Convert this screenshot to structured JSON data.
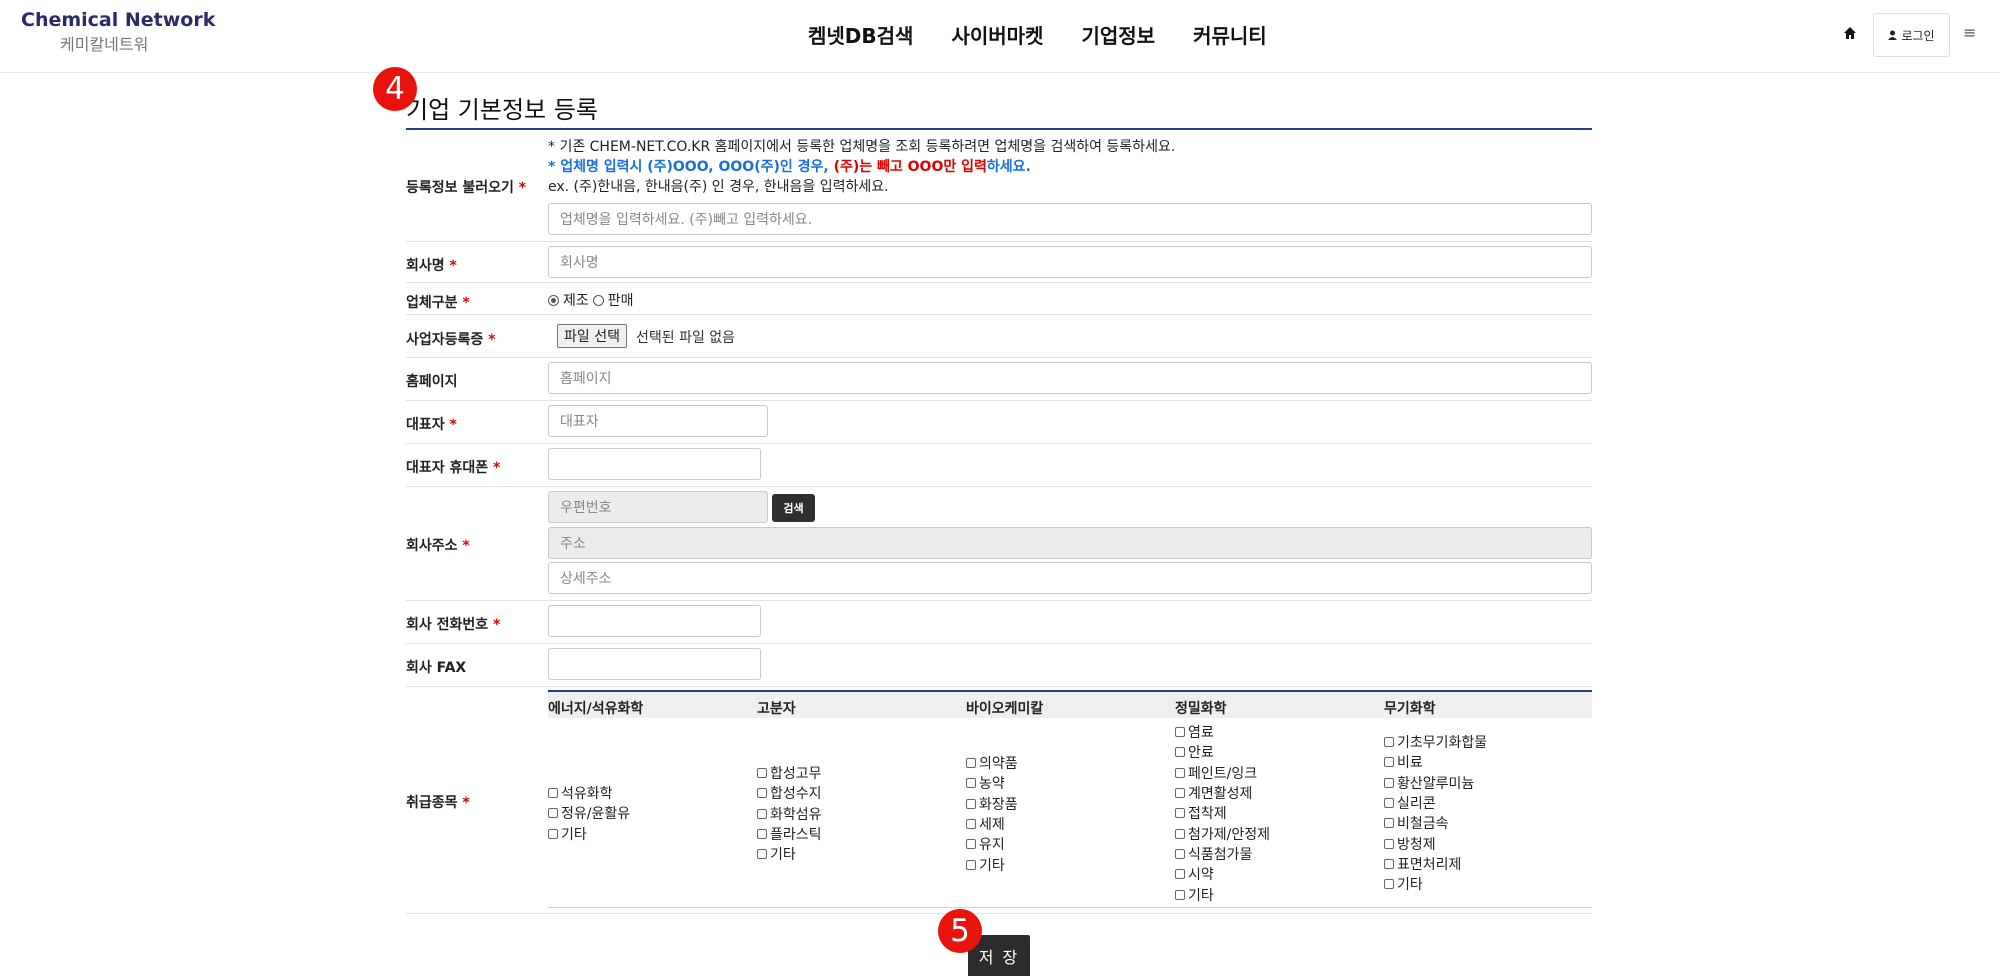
{
  "header": {
    "logo_en": "Chemical Network",
    "logo_ko": "케미칼네트워",
    "nav": [
      "켐넷DB검색",
      "사이버마켓",
      "기업정보",
      "커뮤니티"
    ],
    "login_label": "로그인",
    "menu_glyph": "≡"
  },
  "markers": {
    "step4": "4",
    "step5": "5"
  },
  "page_title": "기업 기본정보 등록",
  "required_mark": "*",
  "fields": {
    "load": {
      "label": "등록정보 불러오기",
      "notice1": "* 기존 CHEM-NET.CO.KR 홈페이지에서 등록한 업체명을 조회 등록하려면 업체명을 검색하여 등록하세요.",
      "notice2a": "* 업체명 입력시 (주)OOO, OOO(주)인 경우, ",
      "notice2b": "(주)는 빼고 OOO만 입력",
      "notice2c": "하세요.",
      "notice3": "ex. (주)한내음, 한내음(주) 인 경우, 한내음을 입력하세요.",
      "placeholder": "업체명을 입력하세요. (주)빼고 입력하세요."
    },
    "company_name": {
      "label": "회사명",
      "placeholder": "회사명"
    },
    "company_type": {
      "label": "업체구분",
      "options": [
        "제조",
        "판매"
      ],
      "selected": "제조"
    },
    "biz_reg": {
      "label": "사업자등록증",
      "button": "파일 선택",
      "status": "선택된 파일 없음"
    },
    "homepage": {
      "label": "홈페이지",
      "placeholder": "홈페이지"
    },
    "ceo": {
      "label": "대표자",
      "placeholder": "대표자"
    },
    "ceo_phone": {
      "label": "대표자 휴대폰",
      "placeholder": ""
    },
    "address": {
      "label": "회사주소",
      "zip_placeholder": "우편번호",
      "search_button": "검색",
      "addr_placeholder": "주소",
      "detail_placeholder": "상세주소"
    },
    "phone": {
      "label": "회사 전화번호",
      "placeholder": ""
    },
    "fax": {
      "label": "회사 FAX",
      "placeholder": ""
    },
    "categories": {
      "label": "취급종목",
      "columns": [
        {
          "title": "에너지/석유화학",
          "items": [
            "석유화학",
            "정유/윤활유",
            "기타"
          ]
        },
        {
          "title": "고분자",
          "items": [
            "합성고무",
            "합성수지",
            "화학섬유",
            "플라스틱",
            "기타"
          ]
        },
        {
          "title": "바이오케미칼",
          "items": [
            "의약품",
            "농약",
            "화장품",
            "세제",
            "유지",
            "기타"
          ]
        },
        {
          "title": "정밀화학",
          "items": [
            "염료",
            "안료",
            "페인트/잉크",
            "계면활성제",
            "접착제",
            "첨가제/안정제",
            "식품첨가물",
            "시약",
            "기타"
          ]
        },
        {
          "title": "무기화학",
          "items": [
            "기초무기화합물",
            "비료",
            "황산알루미늄",
            "실리콘",
            "비철금속",
            "방청제",
            "표면처리제",
            "기타"
          ]
        }
      ]
    }
  },
  "save_button": "저 장",
  "colors": {
    "accent": "#1e3f94",
    "marker": "#e8130d",
    "required": "#e00000",
    "notice_blue": "#1a6fe0"
  }
}
